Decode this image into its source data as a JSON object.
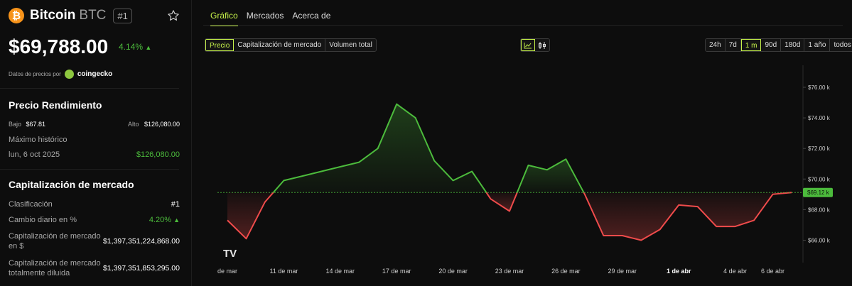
{
  "coin": {
    "logo_glyph": "₿",
    "name": "Bitcoin",
    "symbol": "BTC",
    "rank": "#1",
    "price": "$69,788.00",
    "change": "4.14%",
    "change_arrow": "▲"
  },
  "data_by": {
    "label": "Datos de precios por",
    "source": "coingecko"
  },
  "performance": {
    "title": "Precio Rendimiento",
    "low_label": "Bajo",
    "low_value": "$67.81",
    "high_label": "Alto",
    "high_value": "$126,080.00",
    "ath_label": "Máximo histórico",
    "ath_date": "lun, 6 oct 2025",
    "ath_value": "$126,080.00"
  },
  "market_cap": {
    "title": "Capitalización de mercado",
    "rank_label": "Clasificación",
    "rank_value": "#1",
    "daily_change_label": "Cambio diario en %",
    "daily_change_value": "4.20%",
    "daily_change_arrow": "▲",
    "mcap_label_1": "Capitalización de mercado",
    "mcap_label_2": "en $",
    "mcap_value": "$1,397,351,224,868.00",
    "fdv_label_1": "Capitalización de mercado",
    "fdv_label_2": "totalmente diluida",
    "fdv_value": "$1,397,351,853,295.00"
  },
  "tabs": [
    {
      "label": "Gráfico",
      "active": true
    },
    {
      "label": "Mercados",
      "active": false
    },
    {
      "label": "Acerca de",
      "active": false
    }
  ],
  "metric_buttons": [
    "Precio",
    "Capitalización de mercado",
    "Volumen total"
  ],
  "metric_active": "Precio",
  "view_icons": [
    "line-chart-icon",
    "candlestick-icon"
  ],
  "range_buttons": [
    "24h",
    "7d",
    "1 m",
    "90d",
    "180d",
    "1 año",
    "todos"
  ],
  "range_active": "1 m",
  "colors": {
    "accent": "#c6f24a",
    "up": "#4cbb3c",
    "down": "#ef4b4b",
    "btc": "#f7931a"
  },
  "chart_data": {
    "type": "line",
    "x": [
      "8 mar",
      "9 mar",
      "10 mar",
      "11 mar",
      "12 mar",
      "13 mar",
      "14 mar",
      "15 mar",
      "16 mar",
      "17 mar",
      "18 mar",
      "19 mar",
      "20 mar",
      "21 mar",
      "22 mar",
      "23 mar",
      "24 mar",
      "25 mar",
      "26 mar",
      "27 mar",
      "28 mar",
      "29 mar",
      "30 mar",
      "31 mar",
      "1 abr",
      "2 abr",
      "3 abr",
      "4 abr",
      "5 abr",
      "6 abr",
      "7 abr"
    ],
    "values": [
      67300,
      66100,
      68500,
      69900,
      70200,
      70500,
      70800,
      71100,
      72000,
      74900,
      74000,
      71200,
      69900,
      70500,
      68700,
      67900,
      70900,
      70600,
      71300,
      69000,
      66300,
      66300,
      66000,
      66700,
      68300,
      68200,
      66900,
      66900,
      67300,
      69000,
      69120
    ],
    "baseline": 69120,
    "current_label": "$69.12 k",
    "y_ticks": [
      "$66.00 k",
      "$68.00 k",
      "$70.00 k",
      "$72.00 k",
      "$74.00 k",
      "$76.00 k"
    ],
    "y_tick_values": [
      66000,
      68000,
      70000,
      72000,
      74000,
      76000
    ],
    "ylim": [
      65000,
      77300
    ],
    "x_ticks": [
      "de mar",
      "11 de mar",
      "14 de mar",
      "17 de mar",
      "20 de mar",
      "23 de mar",
      "26 de mar",
      "29 de mar",
      "1 de abr",
      "4 de abr",
      "6 de abr"
    ],
    "x_tick_days": [
      8,
      11,
      14,
      17,
      20,
      23,
      26,
      29,
      32,
      35,
      37
    ],
    "bold_x_tick": "1 de abr",
    "watermark": "TV"
  }
}
